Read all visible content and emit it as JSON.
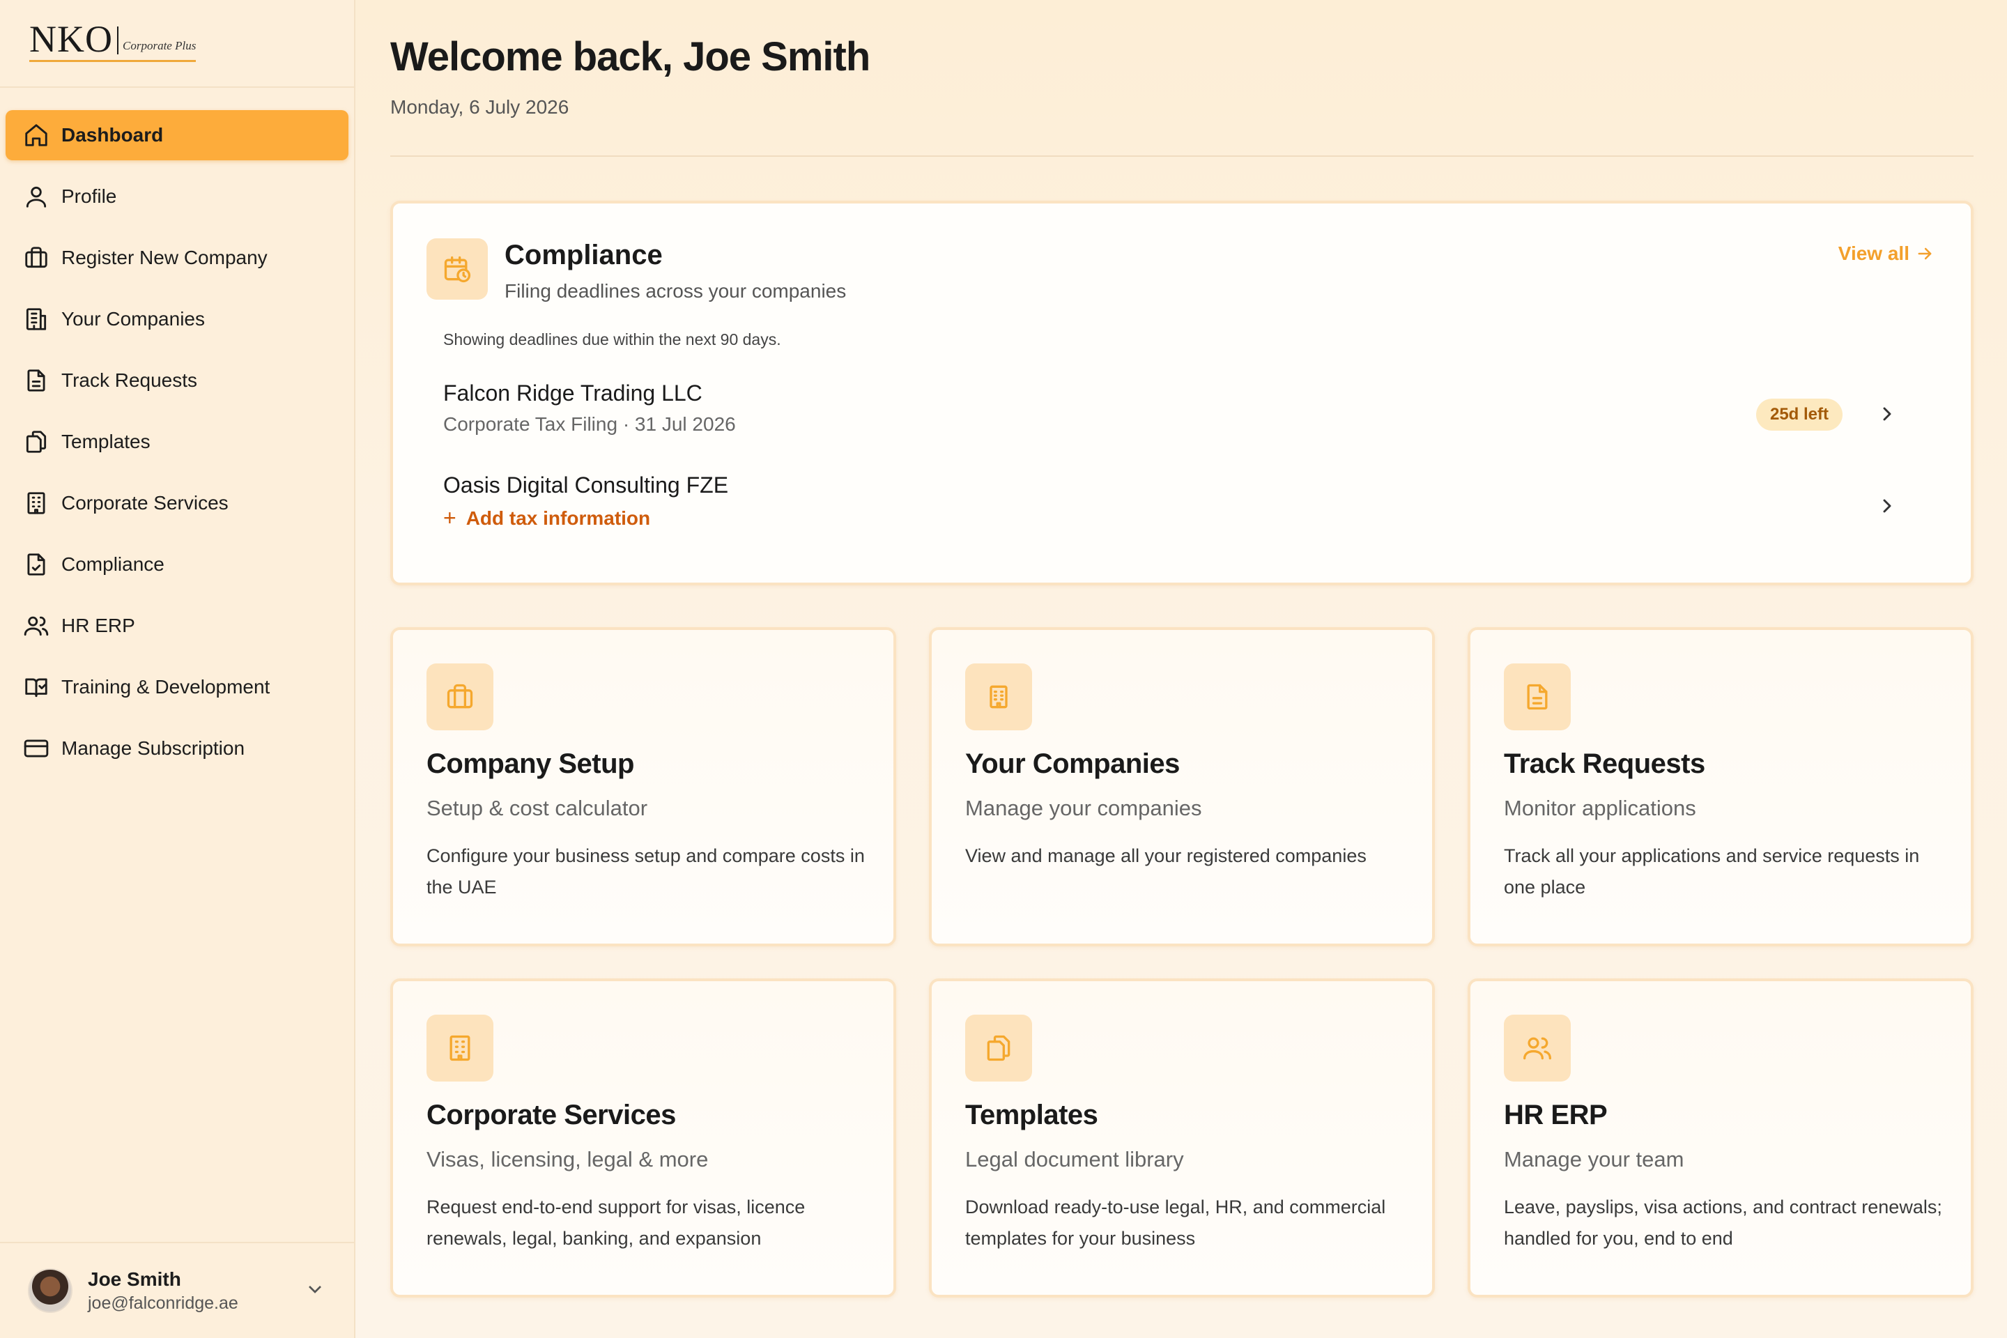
{
  "logo": {
    "main": "NKO",
    "sub": "Corporate Plus"
  },
  "sidebar": {
    "items": [
      {
        "label": "Dashboard",
        "icon": "home-icon",
        "active": true
      },
      {
        "label": "Profile",
        "icon": "user-icon"
      },
      {
        "label": "Register New Company",
        "icon": "briefcase-icon"
      },
      {
        "label": "Your Companies",
        "icon": "building-icon"
      },
      {
        "label": "Track Requests",
        "icon": "document-icon"
      },
      {
        "label": "Templates",
        "icon": "copy-icon"
      },
      {
        "label": "Corporate Services",
        "icon": "office-icon"
      },
      {
        "label": "Compliance",
        "icon": "file-check-icon"
      },
      {
        "label": "HR ERP",
        "icon": "users-icon"
      },
      {
        "label": "Training & Development",
        "icon": "book-icon"
      },
      {
        "label": "Manage Subscription",
        "icon": "credit-card-icon"
      }
    ]
  },
  "user": {
    "name": "Joe Smith",
    "email": "joe@falconridge.ae"
  },
  "header": {
    "welcome": "Welcome back, Joe Smith",
    "date": "Monday, 6 July 2026"
  },
  "compliance": {
    "title": "Compliance",
    "subtitle": "Filing deadlines across your companies",
    "view_all": "View all",
    "note": "Showing deadlines due within the next 90 days.",
    "rows": [
      {
        "company": "Falcon Ridge Trading LLC",
        "detail": "Corporate Tax Filing · 31 Jul 2026",
        "badge": "25d left"
      },
      {
        "company": "Oasis Digital Consulting FZE",
        "action": "Add tax information"
      }
    ]
  },
  "tiles": [
    {
      "title": "Company Setup",
      "subtitle": "Setup & cost calculator",
      "desc": "Configure your business setup and compare costs in the UAE",
      "icon": "briefcase-icon"
    },
    {
      "title": "Your Companies",
      "subtitle": "Manage your companies",
      "desc": "View and manage all your registered companies",
      "icon": "building-icon"
    },
    {
      "title": "Track Requests",
      "subtitle": "Monitor applications",
      "desc": "Track all your applications and service requests in one place",
      "icon": "document-icon"
    },
    {
      "title": "Corporate Services",
      "subtitle": "Visas, licensing, legal & more",
      "desc": "Request end-to-end support for visas, licence renewals, legal, banking, and expansion",
      "icon": "office-icon"
    },
    {
      "title": "Templates",
      "subtitle": "Legal document library",
      "desc": "Download ready-to-use legal, HR, and commercial templates for your business",
      "icon": "copy-icon"
    },
    {
      "title": "HR ERP",
      "subtitle": "Manage your team",
      "desc": "Leave, payslips, visa actions, and contract renewals; handled for you, end to end",
      "icon": "users-icon"
    }
  ],
  "colors": {
    "accent": "#fdac3b",
    "accent_text": "#f3a02c",
    "action_text": "#cf5c0c",
    "badge_bg": "#fde9bf"
  }
}
